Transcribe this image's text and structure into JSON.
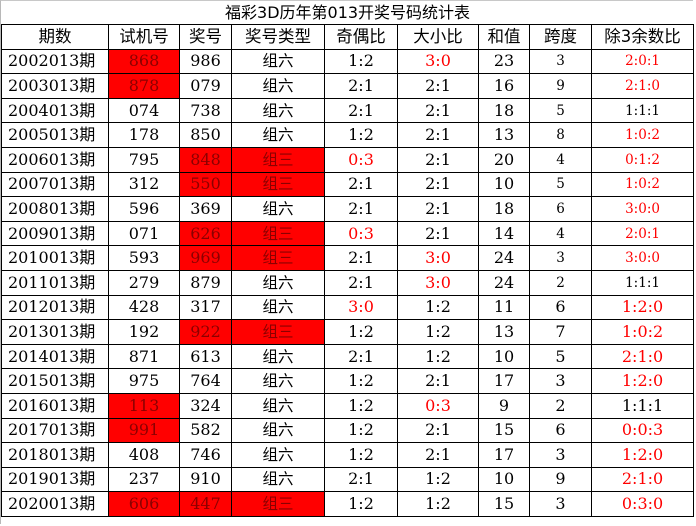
{
  "title": "福彩3D历年第013开奖号码统计表",
  "headers": [
    "期数",
    "试机号",
    "奖号",
    "奖号类型",
    "奇偶比",
    "大小比",
    "和值",
    "跨度",
    "除3余数比"
  ],
  "colors": {
    "highlight_bg": "#ff0000",
    "highlight_text": "#8b0000",
    "accent_text": "#ff0000"
  },
  "rows": [
    {
      "period": "2002013期",
      "test": "868",
      "test_hl": true,
      "draw": "986",
      "draw_hl": false,
      "type": "组六",
      "type_hl": false,
      "oe": "1:2",
      "oe_red": false,
      "bs": "3:0",
      "bs_red": true,
      "sum": "23",
      "span": "3",
      "mod3": "2:0:1",
      "mod3_red": true
    },
    {
      "period": "2003013期",
      "test": "878",
      "test_hl": true,
      "draw": "079",
      "draw_hl": false,
      "type": "组六",
      "type_hl": false,
      "oe": "2:1",
      "oe_red": false,
      "bs": "2:1",
      "bs_red": false,
      "sum": "16",
      "span": "9",
      "mod3": "2:1:0",
      "mod3_red": true
    },
    {
      "period": "2004013期",
      "test": "074",
      "test_hl": false,
      "draw": "738",
      "draw_hl": false,
      "type": "组六",
      "type_hl": false,
      "oe": "2:1",
      "oe_red": false,
      "bs": "2:1",
      "bs_red": false,
      "sum": "18",
      "span": "5",
      "mod3": "1:1:1",
      "mod3_red": false
    },
    {
      "period": "2005013期",
      "test": "178",
      "test_hl": false,
      "draw": "850",
      "draw_hl": false,
      "type": "组六",
      "type_hl": false,
      "oe": "1:2",
      "oe_red": false,
      "bs": "2:1",
      "bs_red": false,
      "sum": "13",
      "span": "8",
      "mod3": "1:0:2",
      "mod3_red": true
    },
    {
      "period": "2006013期",
      "test": "795",
      "test_hl": false,
      "draw": "848",
      "draw_hl": true,
      "type": "组三",
      "type_hl": true,
      "oe": "0:3",
      "oe_red": true,
      "bs": "2:1",
      "bs_red": false,
      "sum": "20",
      "span": "4",
      "mod3": "0:1:2",
      "mod3_red": true
    },
    {
      "period": "2007013期",
      "test": "312",
      "test_hl": false,
      "draw": "550",
      "draw_hl": true,
      "type": "组三",
      "type_hl": true,
      "oe": "2:1",
      "oe_red": false,
      "bs": "2:1",
      "bs_red": false,
      "sum": "10",
      "span": "5",
      "mod3": "1:0:2",
      "mod3_red": true
    },
    {
      "period": "2008013期",
      "test": "596",
      "test_hl": false,
      "draw": "369",
      "draw_hl": false,
      "type": "组六",
      "type_hl": false,
      "oe": "2:1",
      "oe_red": false,
      "bs": "2:1",
      "bs_red": false,
      "sum": "18",
      "span": "6",
      "mod3": "3:0:0",
      "mod3_red": true
    },
    {
      "period": "2009013期",
      "test": "071",
      "test_hl": false,
      "draw": "626",
      "draw_hl": true,
      "type": "组三",
      "type_hl": true,
      "oe": "0:3",
      "oe_red": true,
      "bs": "2:1",
      "bs_red": false,
      "sum": "14",
      "span": "4",
      "mod3": "2:0:1",
      "mod3_red": true
    },
    {
      "period": "2010013期",
      "test": "593",
      "test_hl": false,
      "draw": "969",
      "draw_hl": true,
      "type": "组三",
      "type_hl": true,
      "oe": "2:1",
      "oe_red": false,
      "bs": "3:0",
      "bs_red": true,
      "sum": "24",
      "span": "3",
      "mod3": "3:0:0",
      "mod3_red": true
    },
    {
      "period": "2011013期",
      "test": "279",
      "test_hl": false,
      "draw": "879",
      "draw_hl": false,
      "type": "组六",
      "type_hl": false,
      "oe": "2:1",
      "oe_red": false,
      "bs": "3:0",
      "bs_red": true,
      "sum": "24",
      "span": "2",
      "mod3": "1:1:1",
      "mod3_red": false
    },
    {
      "period": "2012013期",
      "test": "428",
      "test_hl": false,
      "draw": "317",
      "draw_hl": false,
      "type": "组六",
      "type_hl": false,
      "oe": "3:0",
      "oe_red": true,
      "bs": "1:2",
      "bs_red": false,
      "sum": "11",
      "span": "6",
      "mod3": "1:2:0",
      "mod3_red": true
    },
    {
      "period": "2013013期",
      "test": "192",
      "test_hl": false,
      "draw": "922",
      "draw_hl": true,
      "type": "组三",
      "type_hl": true,
      "oe": "1:2",
      "oe_red": false,
      "bs": "1:2",
      "bs_red": false,
      "sum": "13",
      "span": "7",
      "mod3": "1:0:2",
      "mod3_red": true
    },
    {
      "period": "2014013期",
      "test": "871",
      "test_hl": false,
      "draw": "613",
      "draw_hl": false,
      "type": "组六",
      "type_hl": false,
      "oe": "2:1",
      "oe_red": false,
      "bs": "1:2",
      "bs_red": false,
      "sum": "10",
      "span": "5",
      "mod3": "2:1:0",
      "mod3_red": true
    },
    {
      "period": "2015013期",
      "test": "975",
      "test_hl": false,
      "draw": "764",
      "draw_hl": false,
      "type": "组六",
      "type_hl": false,
      "oe": "1:2",
      "oe_red": false,
      "bs": "2:1",
      "bs_red": false,
      "sum": "17",
      "span": "3",
      "mod3": "1:2:0",
      "mod3_red": true
    },
    {
      "period": "2016013期",
      "test": "113",
      "test_hl": true,
      "draw": "324",
      "draw_hl": false,
      "type": "组六",
      "type_hl": false,
      "oe": "1:2",
      "oe_red": false,
      "bs": "0:3",
      "bs_red": true,
      "sum": "9",
      "span": "2",
      "mod3": "1:1:1",
      "mod3_red": false
    },
    {
      "period": "2017013期",
      "test": "991",
      "test_hl": true,
      "draw": "582",
      "draw_hl": false,
      "type": "组六",
      "type_hl": false,
      "oe": "1:2",
      "oe_red": false,
      "bs": "2:1",
      "bs_red": false,
      "sum": "15",
      "span": "6",
      "mod3": "0:0:3",
      "mod3_red": true
    },
    {
      "period": "2018013期",
      "test": "408",
      "test_hl": false,
      "draw": "746",
      "draw_hl": false,
      "type": "组六",
      "type_hl": false,
      "oe": "1:2",
      "oe_red": false,
      "bs": "2:1",
      "bs_red": false,
      "sum": "17",
      "span": "3",
      "mod3": "1:2:0",
      "mod3_red": true
    },
    {
      "period": "2019013期",
      "test": "237",
      "test_hl": false,
      "draw": "910",
      "draw_hl": false,
      "type": "组六",
      "type_hl": false,
      "oe": "2:1",
      "oe_red": false,
      "bs": "1:2",
      "bs_red": false,
      "sum": "10",
      "span": "9",
      "mod3": "2:1:0",
      "mod3_red": true
    },
    {
      "period": "2020013期",
      "test": "606",
      "test_hl": true,
      "draw": "447",
      "draw_hl": true,
      "type": "组三",
      "type_hl": true,
      "oe": "1:2",
      "oe_red": false,
      "bs": "1:2",
      "bs_red": false,
      "sum": "15",
      "span": "3",
      "mod3": "0:3:0",
      "mod3_red": true
    }
  ]
}
